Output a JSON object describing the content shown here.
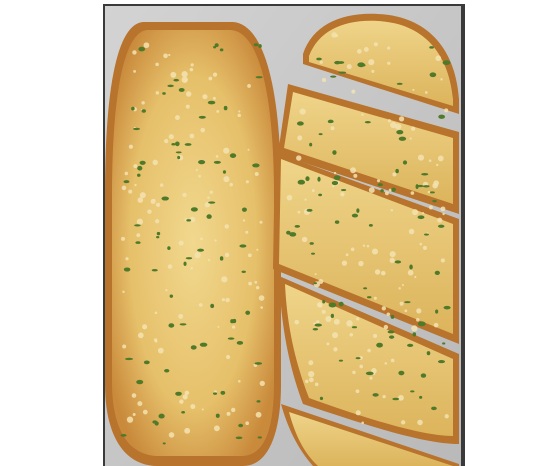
{
  "image": {
    "subject": "garlic bread",
    "pan_color": "#c9c9c9",
    "crust_color": "#c98a3c",
    "crumb_color": "#e9c978",
    "cheese_color": "#f3e3b0",
    "herb_color": "#4f7a2a",
    "frame_border_color": "#3a3a3a"
  }
}
